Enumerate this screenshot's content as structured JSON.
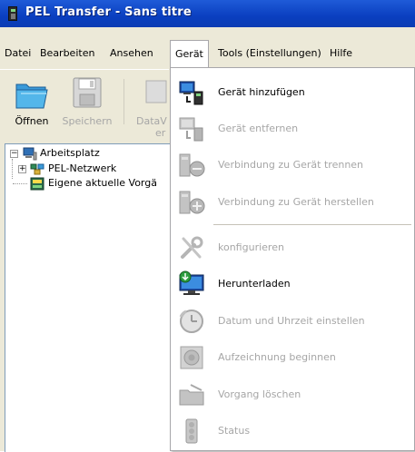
{
  "window": {
    "title": "PEL Transfer - Sans titre"
  },
  "menubar": {
    "items": [
      {
        "label": "Datei"
      },
      {
        "label": "Bearbeiten"
      },
      {
        "label": "Ansehen"
      },
      {
        "label": "Gerät"
      },
      {
        "label": "Tools (Einstellungen)"
      },
      {
        "label": "Hilfe"
      }
    ],
    "open_menu": "Gerät"
  },
  "toolbar": {
    "buttons": [
      {
        "label": "Öffnen",
        "icon": "open-folder-icon",
        "enabled": true
      },
      {
        "label": "Speichern",
        "icon": "save-disk-icon",
        "enabled": false
      },
      {
        "label": "DataV",
        "sublabel": "er",
        "icon": "dataview-icon",
        "enabled": false
      }
    ]
  },
  "tree": {
    "root": {
      "label": "Arbeitsplatz",
      "icon": "workstation-icon",
      "expanded": true
    },
    "children": [
      {
        "label": "PEL-Netzwerk",
        "icon": "network-icon",
        "expander": "+"
      },
      {
        "label": "Eigene aktuelle Vorgä",
        "icon": "recording-icon"
      }
    ]
  },
  "device_menu": {
    "items": [
      {
        "label": "Gerät hinzufügen",
        "icon": "add-device-icon",
        "enabled": true
      },
      {
        "label": "Gerät entfernen",
        "icon": "remove-device-icon",
        "enabled": false
      },
      {
        "label": "Verbindung zu Gerät trennen",
        "icon": "disconnect-device-icon",
        "enabled": false
      },
      {
        "label": "Verbindung zu Gerät herstellen",
        "icon": "connect-device-icon",
        "enabled": false
      },
      {
        "label": "konfigurieren",
        "icon": "tools-wrench-icon",
        "enabled": false
      },
      {
        "label": "Herunterladen",
        "icon": "download-monitor-icon",
        "enabled": true
      },
      {
        "label": "Datum und Uhrzeit einstellen",
        "icon": "clock-icon",
        "enabled": false
      },
      {
        "label": "Aufzeichnung beginnen",
        "icon": "record-speaker-icon",
        "enabled": false
      },
      {
        "label": "Vorgang löschen",
        "icon": "delete-folder-icon",
        "enabled": false
      },
      {
        "label": "Status",
        "icon": "status-traffic-light-icon",
        "enabled": false
      }
    ]
  },
  "colors": {
    "titlebar": "#0a3fc0",
    "menu_bg": "#ece9d8",
    "disabled_text": "#a6a6a6"
  }
}
